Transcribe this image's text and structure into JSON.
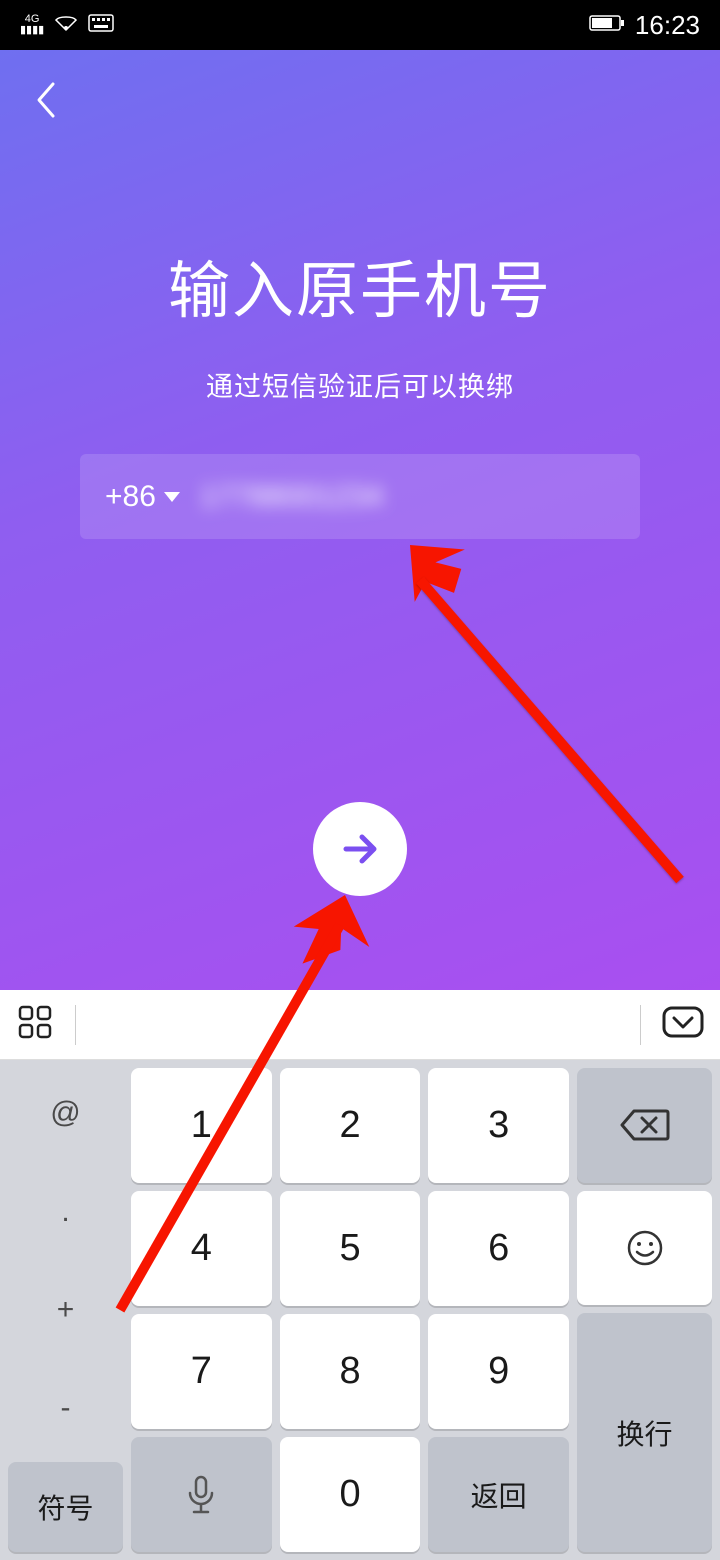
{
  "statusbar": {
    "network": "4G",
    "time": "16:23"
  },
  "page": {
    "title": "输入原手机号",
    "subtitle": "通过短信验证后可以换绑",
    "country_code": "+86",
    "phone_value": "17788001234"
  },
  "keyboard": {
    "symbols": [
      "@",
      ".",
      "+",
      "-"
    ],
    "nums": [
      "1",
      "2",
      "3",
      "4",
      "5",
      "6",
      "7",
      "8",
      "9",
      "0"
    ],
    "fn_symbol": "符号",
    "fn_back": "返回",
    "fn_newline": "换行"
  }
}
